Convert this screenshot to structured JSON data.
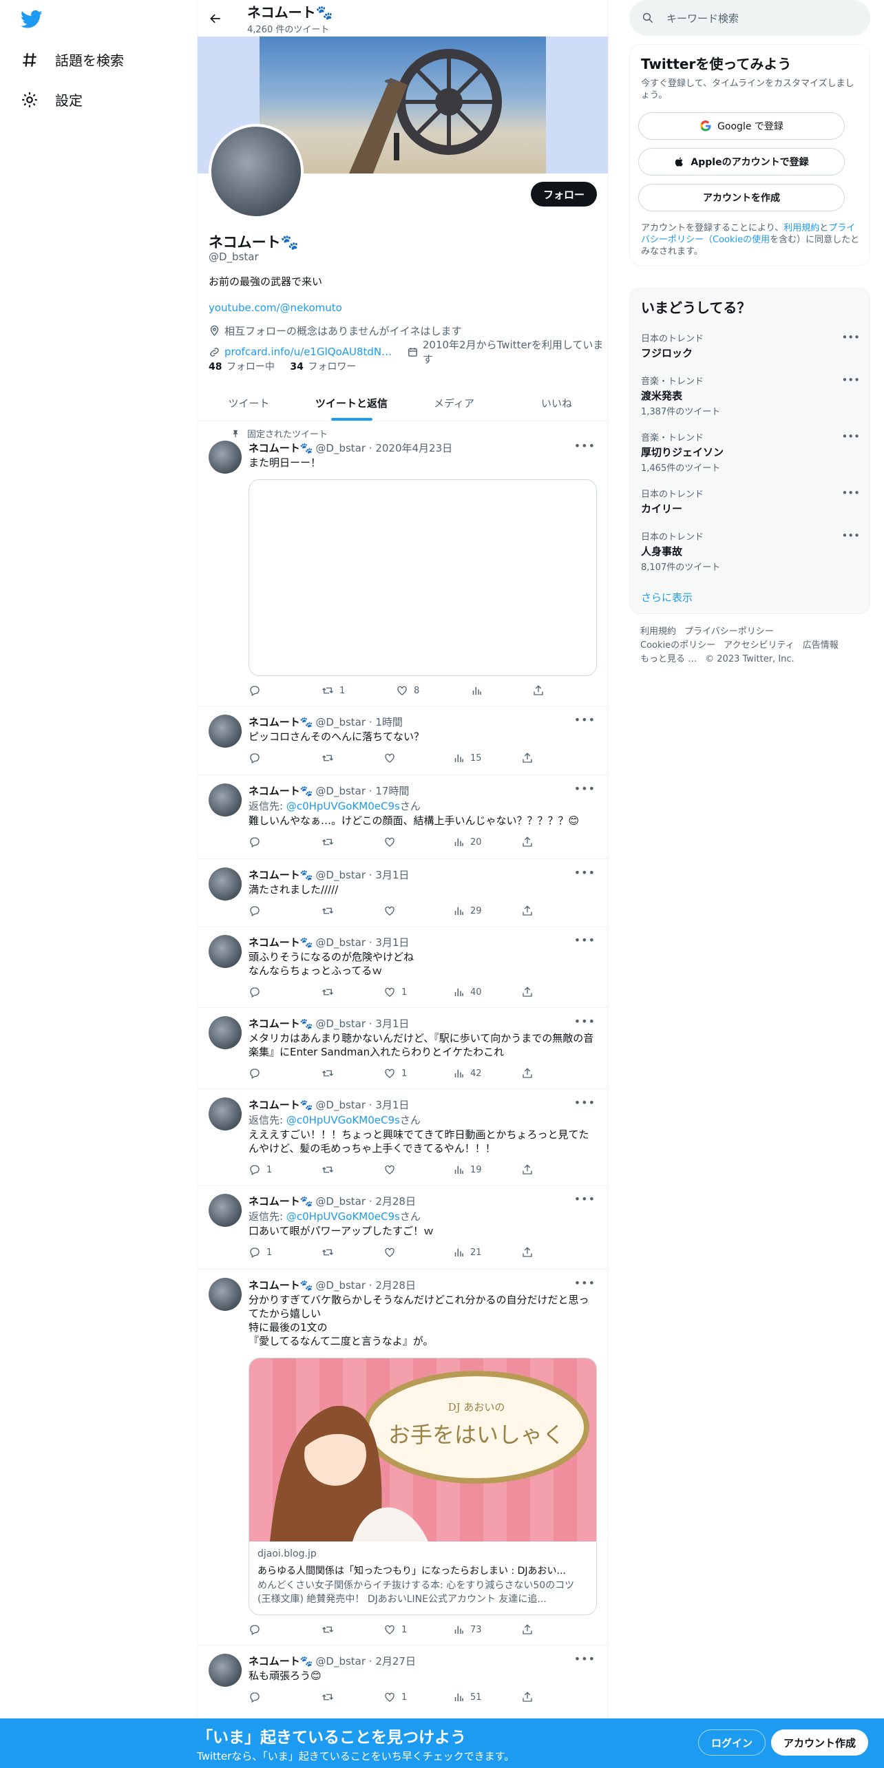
{
  "nav": {
    "explore_label": "話題を検索",
    "settings_label": "設定"
  },
  "header": {
    "name": "ネコムート🐾",
    "tweet_count": "4,260 件のツイート"
  },
  "profile": {
    "follow_label": "フォロー",
    "name": "ネコムート🐾",
    "handle": "@D_bstar",
    "bio": "お前の最強の武器で来い",
    "link": "youtube.com/@nekomuto",
    "location": "相互フォローの概念はありませんがイイネはします",
    "url": "profcard.info/u/e1GlQoAU8tdN…",
    "joined": "2010年2月からTwitterを利用しています",
    "following_count": "48",
    "following_label": "フォロー中",
    "followers_count": "34",
    "followers_label": "フォロワー"
  },
  "tabs": [
    {
      "label": "ツイート"
    },
    {
      "label": "ツイートと返信"
    },
    {
      "label": "メディア"
    },
    {
      "label": "いいね"
    }
  ],
  "pinned_label": "固定されたツイート",
  "tweets": [
    {
      "name": "ネコムート🐾",
      "meta": "@D_bstar · 2020年4月23日",
      "text": "また明日ーー！",
      "reply": "",
      "retweets": "1",
      "likes": "8",
      "views": "",
      "replies": ""
    },
    {
      "name": "ネコムート🐾",
      "meta": "@D_bstar · 1時間",
      "text": "ピッコロさんそのへんに落ちてない？",
      "reply": "",
      "retweets": "",
      "likes": "",
      "views": "15",
      "replies": ""
    },
    {
      "name": "ネコムート🐾",
      "meta": "@D_bstar · 17時間",
      "reply_prefix": "返信先: ",
      "reply_handle": "@c0HpUVGoKM0eC9s",
      "reply_suffix": "さん",
      "text": "難しいんやなぁ…。けどこの顔面、結構上手いんじゃない？？？？？😊",
      "retweets": "",
      "likes": "",
      "views": "20",
      "replies": ""
    },
    {
      "name": "ネコムート🐾",
      "meta": "@D_bstar · 3月1日",
      "text": "満たされました/////",
      "retweets": "",
      "likes": "",
      "views": "29",
      "replies": ""
    },
    {
      "name": "ネコムート🐾",
      "meta": "@D_bstar · 3月1日",
      "text": "頭ふりそうになるのが危険やけどね\nなんならちょっとふってるｗ",
      "retweets": "",
      "likes": "1",
      "views": "40",
      "replies": ""
    },
    {
      "name": "ネコムート🐾",
      "meta": "@D_bstar · 3月1日",
      "text": "メタリカはあんまり聴かないんだけど、『駅に歩いて向かうまでの無敵の音楽集』にEnter Sandman入れたらわりとイケたわこれ",
      "retweets": "",
      "likes": "1",
      "views": "42",
      "replies": ""
    },
    {
      "name": "ネコムート🐾",
      "meta": "@D_bstar · 3月1日",
      "reply_prefix": "返信先: ",
      "reply_handle": "@c0HpUVGoKM0eC9s",
      "reply_suffix": "さん",
      "text": "えええすごい！！！ちょっと興味でてきて昨日動画とかちょろっと見てたんやけど、髪の毛めっちゃ上手くできてるやん！！！",
      "retweets": "",
      "likes": "",
      "views": "19",
      "replies": "1"
    },
    {
      "name": "ネコムート🐾",
      "meta": "@D_bstar · 2月28日",
      "reply_prefix": "返信先: ",
      "reply_handle": "@c0HpUVGoKM0eC9s",
      "reply_suffix": "さん",
      "text": "口あいて眼がパワーアップしたすご！ｗ",
      "retweets": "",
      "likes": "",
      "views": "21",
      "replies": "1"
    },
    {
      "name": "ネコムート🐾",
      "meta": "@D_bstar · 2月28日",
      "text": "分かりすぎてバケ散らかしそうなんだけどこれ分かるの自分だけだと思ってたから嬉しい\n特に最後の1文の\n『愛してるなんて二度と言うなよ』が。",
      "retweets": "",
      "likes": "1",
      "views": "73",
      "replies": ""
    },
    {
      "name": "ネコムート🐾",
      "meta": "@D_bstar · 2月27日",
      "text": "私も頑張ろう😊",
      "retweets": "",
      "likes": "1",
      "views": "51",
      "replies": ""
    }
  ],
  "card": {
    "art_small": "DJ あおいの",
    "art_title": "お手をはいしゃく",
    "domain": "djaoi.blog.jp",
    "title": "あらゆる人間関係は「知ったつもり」になったらおしまい : DJあおい...",
    "desc": "めんどくさい女子関係からイチ抜けする本: 心をすり減らさない50のコツ (王様文庫) 絶賛発売中！ DJあおいLINE公式アカウント 友達に追..."
  },
  "right": {
    "search_placeholder": "キーワード検索",
    "signup_title": "Twitterを使ってみよう",
    "signup_sub": "今すぐ登録して、タイムラインをカスタマイズしましょう。",
    "google_label": "Google で登録",
    "apple_label": "Appleのアカウントで登録",
    "create_label": "アカウントを作成",
    "terms_pre": "アカウントを登録することにより、",
    "terms_link1": "利用規約",
    "terms_mid": "と",
    "terms_link2": "プライバシーポリシー（Cookieの使用",
    "terms_post": "を含む）に同意したとみなされます。",
    "trends_title": "いまどうしてる？",
    "trends": [
      {
        "context": "日本のトレンド",
        "topic": "フジロック",
        "count": ""
      },
      {
        "context": "音楽・トレンド",
        "topic": "渡米発表",
        "count": "1,387件のツイート"
      },
      {
        "context": "音楽・トレンド",
        "topic": "厚切りジェイソン",
        "count": "1,465件のツイート"
      },
      {
        "context": "日本のトレンド",
        "topic": "カイリー",
        "count": ""
      },
      {
        "context": "日本のトレンド",
        "topic": "人身事故",
        "count": "8,107件のツイート"
      }
    ],
    "show_more": "さらに表示",
    "footer_links": [
      "利用規約",
      "プライバシーポリシー",
      "Cookieのポリシー",
      "アクセシビリティ",
      "広告情報",
      "もっと見る …",
      "© 2023 Twitter, Inc."
    ]
  },
  "bottom": {
    "title": "「いま」起きていることを見つけよう",
    "sub": "Twitterなら、「いま」起きていることをいち早くチェックできます。",
    "login": "ログイン",
    "signup": "アカウント作成"
  },
  "colors": {
    "accent": "#1d9bf0",
    "text": "#0f1419",
    "muted": "#536471"
  }
}
